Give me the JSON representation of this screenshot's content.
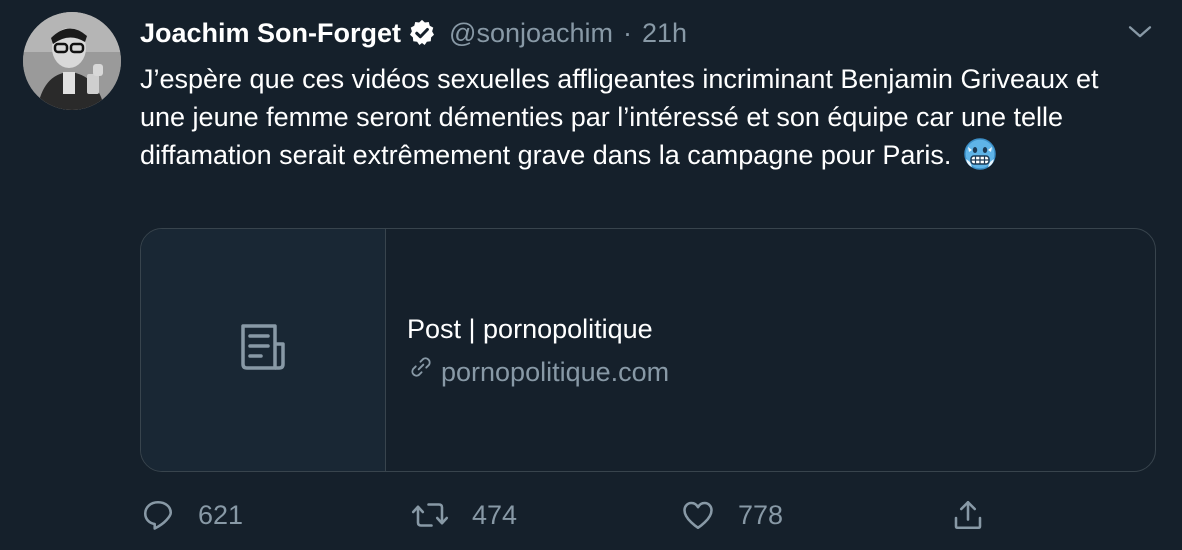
{
  "tweet": {
    "author_name": "Joachim Son-Forget",
    "handle": "@sonjoachim",
    "separator": "·",
    "time": "21h",
    "verified": true,
    "text": "J’espère que ces vidéos sexuelles affligeantes incriminant Benjamin Griveaux et une jeune femme seront démenties par l’intéressé et son équipe car une telle diffamation serait extrêmement grave dans la campagne pour Paris.",
    "emoji": "cold-face-emoji"
  },
  "card": {
    "thumbnail_icon": "document-icon",
    "title": "Post | pornopolitique",
    "domain_icon": "link-icon",
    "domain": "pornopolitique.com"
  },
  "actions": {
    "reply_count": "621",
    "retweet_count": "474",
    "like_count": "778"
  },
  "colors": {
    "background": "#15202b",
    "secondary_text": "#8899a6",
    "border": "#38444d",
    "card_thumb_bg": "#192734"
  }
}
